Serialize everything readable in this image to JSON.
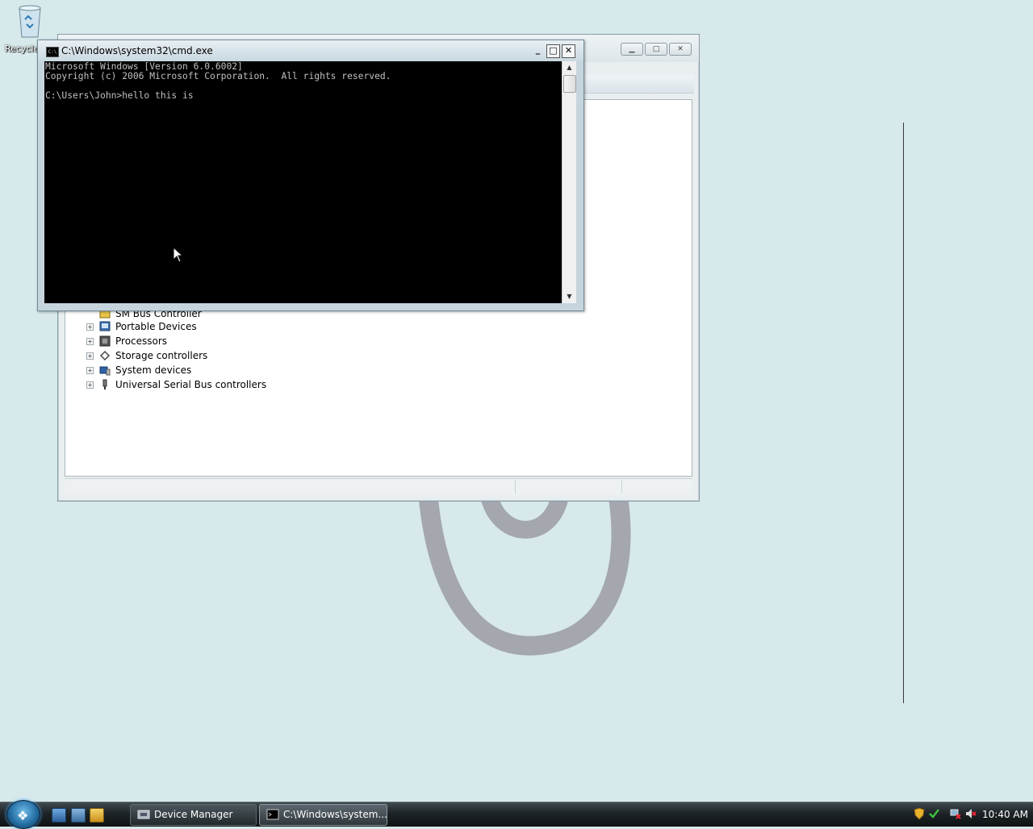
{
  "desktop": {
    "recycle_bin_label": "Recycle"
  },
  "device_manager": {
    "tree_items": [
      {
        "label": "SM Bus Controller",
        "icon": "warning-device-icon"
      },
      {
        "label": "Portable Devices",
        "icon": "portable-device-icon"
      },
      {
        "label": "Processors",
        "icon": "processor-icon"
      },
      {
        "label": "Storage controllers",
        "icon": "storage-controller-icon"
      },
      {
        "label": "System devices",
        "icon": "system-devices-icon"
      },
      {
        "label": "Universal Serial Bus controllers",
        "icon": "usb-icon"
      }
    ]
  },
  "cmd": {
    "title": "C:\\Windows\\system32\\cmd.exe",
    "lines": [
      "Microsoft Windows [Version 6.0.6002]",
      "Copyright (c) 2006 Microsoft Corporation.  All rights reserved.",
      "",
      "C:\\Users\\John>hello this is"
    ]
  },
  "taskbar": {
    "buttons": [
      {
        "label": "Device Manager",
        "icon": "device-manager-icon"
      },
      {
        "label": "C:\\Windows\\system...",
        "icon": "cmd-icon"
      }
    ],
    "clock": "10:40 AM"
  },
  "colors": {
    "desktop_bg": "#d7e9ea",
    "console_bg": "#000000",
    "console_fg": "#c0c0c0"
  }
}
